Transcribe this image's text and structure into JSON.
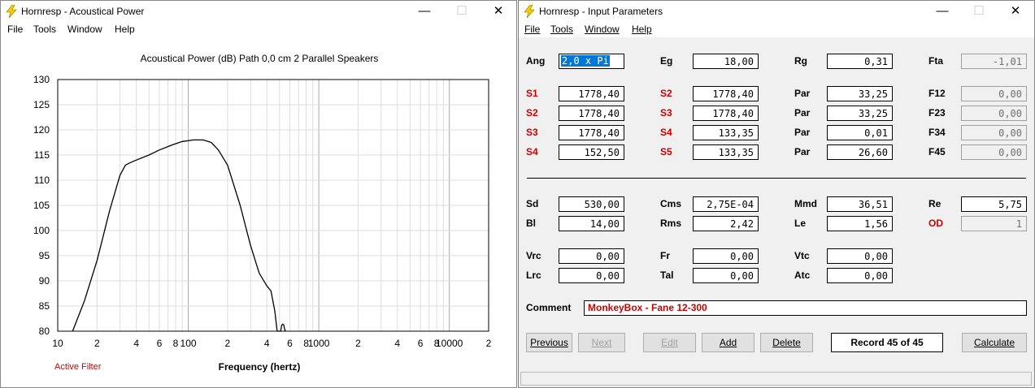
{
  "left_window": {
    "title": "Hornresp - Acoustical Power",
    "menu": [
      "File",
      "Tools",
      "Window",
      "Help"
    ],
    "chart_title": "Acoustical Power (dB)   Path 0,0 cm   2 Parallel Speakers",
    "x_axis_label": "Frequency (hertz)",
    "active_filter": "Active Filter",
    "controls": {
      "minimize": "—",
      "maximize": "☐",
      "close": "✕"
    }
  },
  "chart_data": {
    "type": "line",
    "title": "Acoustical Power (dB)   Path 0,0 cm   2 Parallel Speakers",
    "xlabel": "Frequency (hertz)",
    "ylabel": "",
    "x_scale": "log",
    "xlim": [
      10,
      20000
    ],
    "ylim": [
      80,
      130
    ],
    "y_ticks": [
      "130",
      "125",
      "120",
      "115",
      "110",
      "105",
      "100",
      "95",
      "90",
      "85",
      "80"
    ],
    "x_tick_labels": [
      {
        "value": 10,
        "label": "10"
      },
      {
        "value": 20,
        "label": "2"
      },
      {
        "value": 40,
        "label": "4"
      },
      {
        "value": 60,
        "label": "6"
      },
      {
        "value": 80,
        "label": "8"
      },
      {
        "value": 100,
        "label": "100"
      },
      {
        "value": 200,
        "label": "2"
      },
      {
        "value": 400,
        "label": "4"
      },
      {
        "value": 600,
        "label": "6"
      },
      {
        "value": 800,
        "label": "8"
      },
      {
        "value": 1000,
        "label": "1000"
      },
      {
        "value": 2000,
        "label": "2"
      },
      {
        "value": 4000,
        "label": "4"
      },
      {
        "value": 6000,
        "label": "6"
      },
      {
        "value": 8000,
        "label": "8"
      },
      {
        "value": 10000,
        "label": "10000"
      },
      {
        "value": 20000,
        "label": "2"
      }
    ],
    "grid": true,
    "series": [
      {
        "x": [
          13,
          16,
          20,
          25,
          30,
          33,
          36,
          40,
          50,
          60,
          75,
          90,
          110,
          130,
          150,
          170,
          200,
          250,
          300,
          350,
          400,
          430,
          460,
          480,
          500,
          510,
          520,
          530,
          540,
          550,
          560
        ],
        "y": [
          80,
          86,
          94,
          104,
          111,
          113,
          113.5,
          114,
          115,
          116,
          117,
          117.7,
          118,
          118,
          117.5,
          116,
          113,
          105,
          97,
          91.5,
          89,
          88,
          84,
          80,
          80,
          80,
          81.2,
          81.4,
          81.2,
          80.2,
          80
        ]
      }
    ]
  },
  "right_window": {
    "title": "Hornresp - Input Parameters",
    "menu": [
      "File",
      "Tools",
      "Window",
      "Help"
    ],
    "controls": {
      "minimize": "—",
      "maximize": "☐",
      "close": "✕"
    },
    "rows": {
      "ang": {
        "l1": "Ang",
        "v1": "2,0 x Pi",
        "l2": "Eg",
        "v2": "18,00",
        "l3": "Rg",
        "v3": "0,31",
        "l4": "Fta",
        "v4": "-1,01"
      },
      "r1": {
        "l1": "S1",
        "v1": "1778,40",
        "l2": "S2",
        "v2": "1778,40",
        "l3": "Par",
        "v3": "33,25",
        "l4": "F12",
        "v4": "0,00"
      },
      "r2": {
        "l1": "S2",
        "v1": "1778,40",
        "l2": "S3",
        "v2": "1778,40",
        "l3": "Par",
        "v3": "33,25",
        "l4": "F23",
        "v4": "0,00"
      },
      "r3": {
        "l1": "S3",
        "v1": "1778,40",
        "l2": "S4",
        "v2": "133,35",
        "l3": "Par",
        "v3": "0,01",
        "l4": "F34",
        "v4": "0,00"
      },
      "r4": {
        "l1": "S4",
        "v1": "152,50",
        "l2": "S5",
        "v2": "133,35",
        "l3": "Par",
        "v3": "26,60",
        "l4": "F45",
        "v4": "0,00"
      },
      "d1": {
        "l1": "Sd",
        "v1": "530,00",
        "l2": "Cms",
        "v2": "2,75E-04",
        "l3": "Mmd",
        "v3": "36,51",
        "l4": "Re",
        "v4": "5,75"
      },
      "d2": {
        "l1": "Bl",
        "v1": "14,00",
        "l2": "Rms",
        "v2": "2,42",
        "l3": "Le",
        "v3": "1,56",
        "l4": "OD",
        "v4": "1"
      },
      "c1": {
        "l1": "Vrc",
        "v1": "0,00",
        "l2": "Fr",
        "v2": "0,00",
        "l3": "Vtc",
        "v3": "0,00"
      },
      "c2": {
        "l1": "Lrc",
        "v1": "0,00",
        "l2": "Tal",
        "v2": "0,00",
        "l3": "Atc",
        "v3": "0,00"
      }
    },
    "comment_label": "Comment",
    "comment_value": "MonkeyBox - Fane 12-300",
    "buttons": {
      "previous": "Previous",
      "next": "Next",
      "edit": "Edit",
      "add": "Add",
      "delete": "Delete",
      "record": "Record 45 of 45",
      "calculate": "Calculate"
    }
  }
}
